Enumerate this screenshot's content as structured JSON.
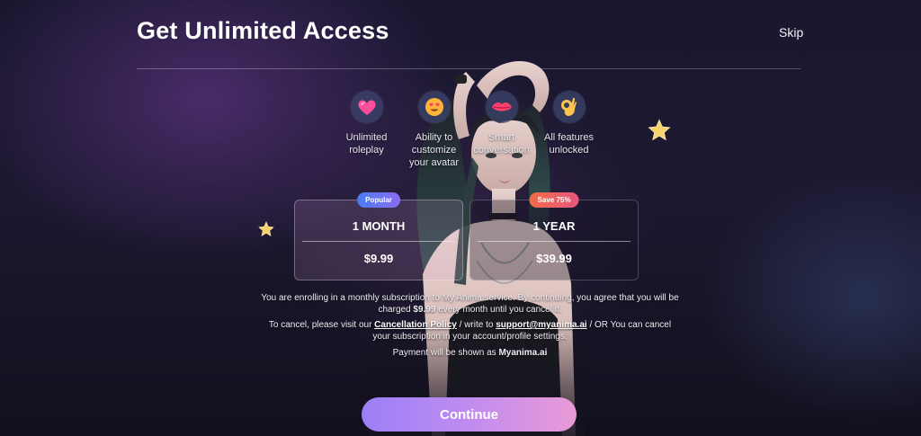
{
  "header": {
    "title": "Get Unlimited Access",
    "skip_label": "Skip"
  },
  "features": [
    {
      "icon": "heart-chat-icon",
      "label": "Unlimited\nroleplay"
    },
    {
      "icon": "heart-eyes-emoji-icon",
      "label": "Ability to\ncustomize\nyour avatar"
    },
    {
      "icon": "kiss-lips-icon",
      "label": "Smart\nconversation"
    },
    {
      "icon": "ok-hand-icon",
      "label": "All features\nunlocked"
    }
  ],
  "plans": [
    {
      "badge": "Popular",
      "name": "1 MONTH",
      "price": "$9.99",
      "selected": true
    },
    {
      "badge": "Save 75%",
      "name": "1 YEAR",
      "price": "$39.99",
      "selected": false
    }
  ],
  "legal": {
    "enroll_prefix": "You are enrolling in a monthly subscription to My Anima service. By continuing, you agree that you will be charged ",
    "enroll_price": "$9.99",
    "enroll_suffix": " every month until you cancel it.",
    "cancel_prefix": "To cancel, please visit our ",
    "cancel_policy_link": "Cancellation Policy",
    "cancel_mid": " / write to ",
    "support_email": "support@myanima.ai",
    "cancel_suffix": " / OR You can cancel your subscription in your account/profile settings.",
    "payment_prefix": "Payment will be shown as ",
    "payment_name": "Myanima.ai"
  },
  "cta": {
    "continue_label": "Continue"
  },
  "colors": {
    "accent_start": "#9b7ff7",
    "accent_end": "#e99ad6",
    "popular_badge": "#4a7cf5",
    "save_badge": "#f46a47"
  }
}
